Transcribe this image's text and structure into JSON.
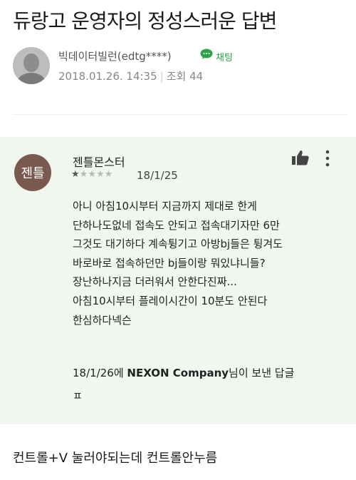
{
  "post": {
    "title": "듀랑고 운영자의 정성스러운 답변",
    "author": "빅데이터빌런(edtg****)",
    "chat_label": "채팅",
    "date": "2018.01.26. 14:35",
    "views": "조회 44"
  },
  "review": {
    "avatar_text": "젠틀",
    "reviewer_name": "젠틀몬스터",
    "rating": 1,
    "rating_max": 5,
    "date": "18/1/25",
    "body_lines": [
      "아니 아침10시부터 지금까지 제대로 한게",
      "단하나도없네 접속도 안되고 접속대기자만 6만",
      "그것도 대기하다 계속튕기고 아방bj들은 튕겨도",
      "바로바로 접속하던만 bj들이랑 뭐있냐니들?",
      "장난하나지금 더러워서 안한다진짜...",
      "아침10시부터 플레이시간이 10분도 안된다",
      "한심하다넥슨"
    ],
    "reply_date": "18/1/26에 ",
    "reply_company": "NEXON Company",
    "reply_suffix": "님이 보낸 답글",
    "reply_text": "ㅍ"
  },
  "caption": "컨트롤+V 눌러야되는데 컨트롤안누름",
  "colors": {
    "card_bg": "#eff7ef",
    "avatar_bg": "#7a5a4e",
    "chat_green": "#2aa34a"
  }
}
